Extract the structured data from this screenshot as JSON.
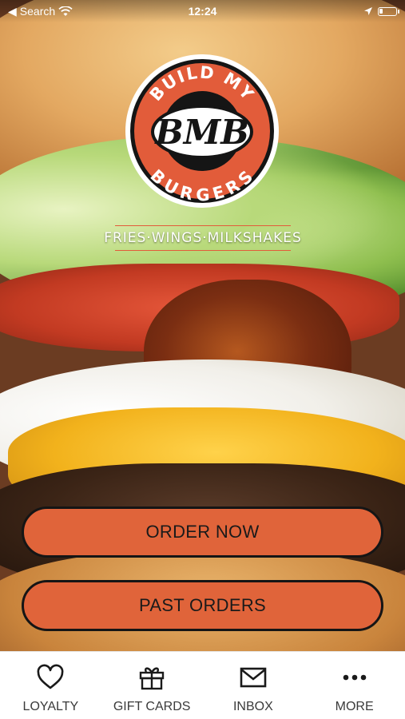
{
  "status_bar": {
    "back_label": "Search",
    "time": "12:24"
  },
  "brand": {
    "logo_top_text": "BUILD MY",
    "logo_center_text": "BMB",
    "logo_bottom_text": "BURGERS",
    "tagline": "FRIES·WINGS·MILKSHAKES"
  },
  "actions": {
    "order_now": "ORDER NOW",
    "past_orders": "PAST ORDERS"
  },
  "tabs": [
    {
      "label": "LOYALTY",
      "icon": "heart-icon"
    },
    {
      "label": "GIFT CARDS",
      "icon": "gift-icon"
    },
    {
      "label": "INBOX",
      "icon": "envelope-icon"
    },
    {
      "label": "MORE",
      "icon": "more-icon"
    }
  ],
  "colors": {
    "accent": "#e0643a",
    "logo_ring": "#e25c3a",
    "dark": "#151515"
  }
}
